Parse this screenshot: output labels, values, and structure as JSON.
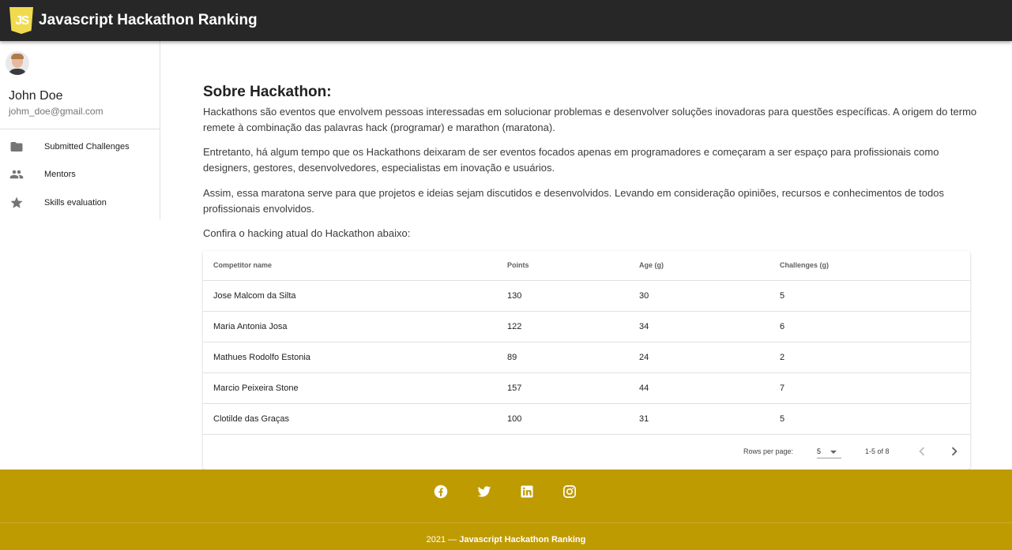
{
  "header": {
    "logo_text": "JS",
    "title": "Javascript Hackathon Ranking"
  },
  "sidebar": {
    "user": {
      "name": "John Doe",
      "email": "johm_doe@gmail.com"
    },
    "items": [
      {
        "label": "Submitted Challenges",
        "icon": "folder-icon"
      },
      {
        "label": "Mentors",
        "icon": "people-icon"
      },
      {
        "label": "Skills evaluation",
        "icon": "star-icon"
      }
    ]
  },
  "main": {
    "title": "Sobre Hackathon:",
    "paragraphs": [
      "Hackathons são eventos que envolvem pessoas interessadas em solucionar problemas e desenvolver soluções inovadoras para questões específicas. A origem do termo remete à combinação das palavras hack (programar) e marathon (maratona).",
      "Entretanto, há algum tempo que os Hackathons deixaram de ser eventos focados apenas em programadores e começaram a ser espaço para profissionais como designers, gestores, desenvolvedores, especialistas em inovação e usuários.",
      "Assim, essa maratona serve para que projetos e ideias sejam discutidos e desenvolvidos. Levando em consideração opiniões, recursos e conhecimentos de todos profissionais envolvidos.",
      "Confira o hacking atual do Hackathon abaixo:"
    ]
  },
  "table": {
    "columns": [
      "Competitor name",
      "Points",
      "Age (g)",
      "Challenges (g)"
    ],
    "rows": [
      [
        "Jose Malcom da Silta",
        "130",
        "30",
        "5"
      ],
      [
        "Maria Antonia Josa",
        "122",
        "34",
        "6"
      ],
      [
        "Mathues Rodolfo Estonia",
        "89",
        "24",
        "2"
      ],
      [
        "Marcio Peixeira Stone",
        "157",
        "44",
        "7"
      ],
      [
        "Clotilde das Graças",
        "100",
        "31",
        "5"
      ]
    ],
    "pagination": {
      "rows_per_page_label": "Rows per page:",
      "rows_per_page_value": "5",
      "range": "1-5 of 8"
    }
  },
  "footer": {
    "social": [
      "facebook-icon",
      "twitter-icon",
      "linkedin-icon",
      "instagram-icon"
    ],
    "copyright_prefix": "2021 —",
    "copyright_name": "Javascript Hackathon Ranking"
  },
  "colors": {
    "header_bg": "#272727",
    "footer_bg": "#bf9b02",
    "logo": "#f0db4f"
  }
}
